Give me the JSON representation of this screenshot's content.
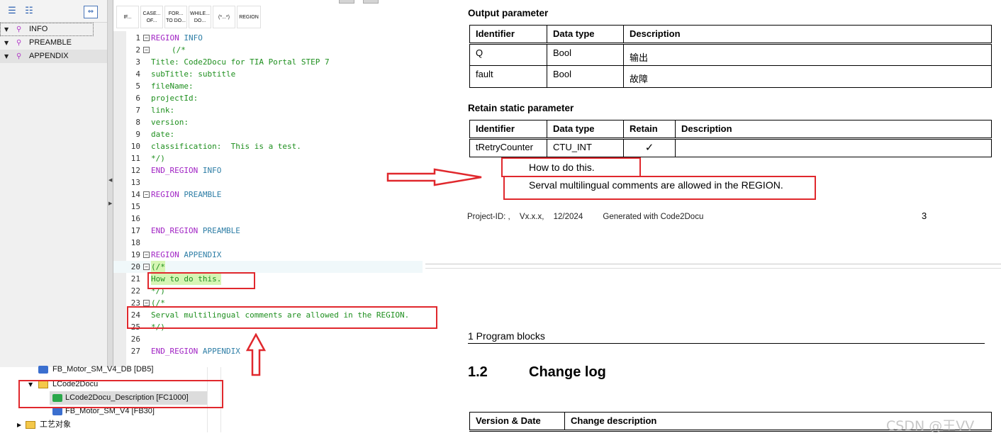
{
  "editor": {
    "nav_items": [
      {
        "label": "INFO"
      },
      {
        "label": "PREAMBLE"
      },
      {
        "label": "APPENDIX"
      }
    ],
    "snippets": [
      "IF...",
      "CASE... OF...",
      "FOR... TO DO...",
      "WHILE... DO...",
      "(*...*)",
      "REGION"
    ],
    "code": {
      "l1": "REGION",
      "l1b": "INFO",
      "l2": "(/*",
      "l3": "Title: Code2Docu for TIA Portal STEP 7",
      "l4": "subTitle: subtitle",
      "l5": "fileName:",
      "l6": "projectId:",
      "l7": "link:",
      "l8": "version:",
      "l9": "date:",
      "l10": "classification:  This is a test.",
      "l11": "*/)",
      "l12": "END_REGION",
      "l12b": "INFO",
      "l14": "REGION",
      "l14b": "PREAMBLE",
      "l17": "END_REGION",
      "l17b": "PREAMBLE",
      "l19": "REGION",
      "l19b": "APPENDIX",
      "l20": "(/*",
      "l21": "How to do this.",
      "l22": "*/)",
      "l23": "(/*",
      "l24": "Serval multilingual comments are allowed in the REGION.",
      "l25": "*/)",
      "l27": "END_REGION",
      "l27b": "APPENDIX"
    }
  },
  "tree": {
    "row0": "FB_Motor_SM_V4_DB [DB5]",
    "row1": "LCode2Docu",
    "row2": "LCode2Docu_Description [FC1000]",
    "row3": "FB_Motor_SM_V4 [FB30]",
    "row4": "工艺对象"
  },
  "doc": {
    "output_title": "Output parameter",
    "output_headers": [
      "Identifier",
      "Data type",
      "Description"
    ],
    "output_rows": [
      [
        "Q",
        "Bool",
        "输出"
      ],
      [
        "fault",
        "Bool",
        "故障"
      ]
    ],
    "retain_title": "Retain static parameter",
    "retain_headers": [
      "Identifier",
      "Data type",
      "Retain",
      "Description"
    ],
    "retain_rows": [
      [
        "tRetryCounter",
        "CTU_INT",
        "✓",
        ""
      ]
    ],
    "comment1": "How to do this.",
    "comment2": "Serval multilingual comments are allowed in the REGION.",
    "footer": {
      "project": "Project-ID: ,",
      "version": "Vx.x.x,",
      "date": "12/2024",
      "generated": "Generated with Code2Docu",
      "page": "3"
    },
    "chapter": "1 Program blocks",
    "section_num": "1.2",
    "section_title": "Change log",
    "changelog_headers": [
      "Version & Date",
      "Change description"
    ],
    "watermark": "CSDN @王VV"
  },
  "colors": {
    "annotation_red": "#e0282d",
    "keyword": "#a124c4",
    "region_name": "#2e7ea6",
    "comment": "#1e8f1e",
    "highlight": "#d6f5b4"
  }
}
